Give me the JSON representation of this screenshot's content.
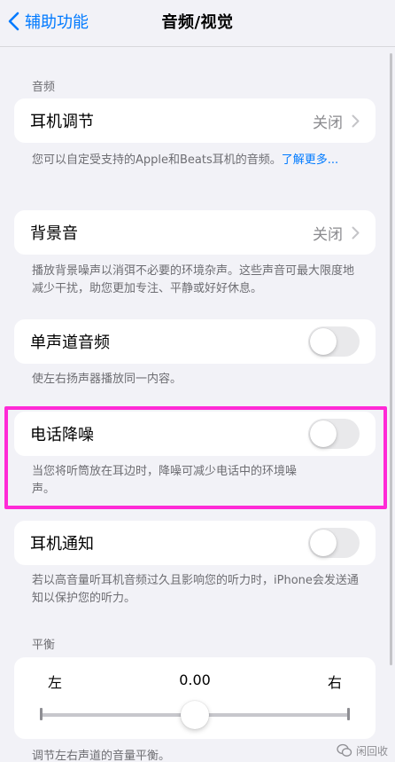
{
  "nav": {
    "back_label": "辅助功能",
    "title": "音频/视觉"
  },
  "audio_section": {
    "header": "音频"
  },
  "rows": {
    "headphone_accommodations": {
      "label": "耳机调节",
      "value": "关闭",
      "footnote": "您可以自定受支持的Apple和Beats耳机的音频。",
      "footnote_link": "了解更多..."
    },
    "background_sounds": {
      "label": "背景音",
      "value": "关闭",
      "footnote": "播放背景噪声以消弭不必要的环境杂声。这些声音可最大限度地减少干扰，助您更加专注、平静或好好休息。"
    },
    "mono_audio": {
      "label": "单声道音频",
      "toggle_on": false,
      "footnote": "使左右扬声器播放同一内容。"
    },
    "phone_noise_cancellation": {
      "label": "电话降噪",
      "toggle_on": false,
      "footnote": "当您将听筒放在耳边时，降噪可减少电话中的环境噪声。"
    },
    "headphone_notifications": {
      "label": "耳机通知",
      "toggle_on": false,
      "footnote": "若以高音量听耳机音频过久且影响您的听力时，iPhone会发送通知以保护您的听力。"
    }
  },
  "balance": {
    "header": "平衡",
    "left_label": "左",
    "right_label": "右",
    "value": "0.00",
    "footnote": "调节左右声道的音量平衡。"
  },
  "watermark": {
    "text": "闲回收"
  },
  "colors": {
    "accent": "#007aff",
    "highlight": "#ff2ad6",
    "background": "#f2f2f7"
  }
}
